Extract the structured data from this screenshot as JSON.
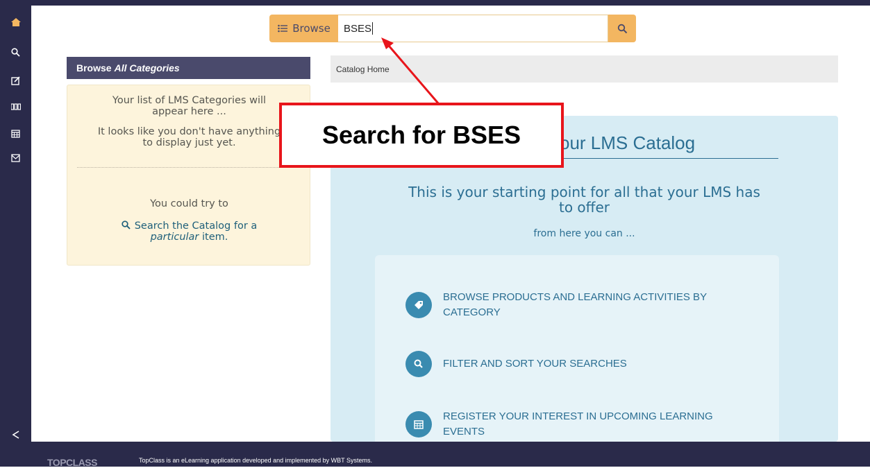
{
  "search": {
    "browse_label": "Browse",
    "value": "BSES",
    "search_icon": "search-icon"
  },
  "sidebar": {
    "icons": [
      "home-icon",
      "search-icon",
      "edit-icon",
      "grid-icon",
      "calendar-icon",
      "mail-icon",
      "share-icon",
      "swap-icon"
    ]
  },
  "panel": {
    "header_prefix": "Browse",
    "header_emph": "All Categories",
    "line1": "Your list of LMS Categories will",
    "line2": "appear here ...",
    "line3": "It looks like you don't have anything",
    "line4": "to display just yet.",
    "try_text": "You could try to",
    "link_line1": "Search the Catalog for a",
    "link_emph": "particular",
    "link_tail": "item."
  },
  "breadcrumb": {
    "home": "Catalog Home"
  },
  "welcome": {
    "title": "our LMS Catalog",
    "subtitle_line1": "This is your starting point for all that your LMS has",
    "subtitle_line2": "to offer",
    "subtitle_small": "from here you can ...",
    "features": [
      {
        "icon": "tag-icon",
        "line1": "Browse products and learning activities by",
        "line2": "category"
      },
      {
        "icon": "search-icon",
        "line1": "Filter and sort your searches",
        "line2": ""
      },
      {
        "icon": "calendar-icon",
        "line1": "Register your interest in upcoming learning",
        "line2": "events"
      }
    ]
  },
  "footer": {
    "brand": "TOPCLASS",
    "text": "TopClass is an eLearning application developed and implemented by WBT Systems."
  },
  "annotation": {
    "callout": "Search for BSES",
    "color": "#e8151b"
  }
}
